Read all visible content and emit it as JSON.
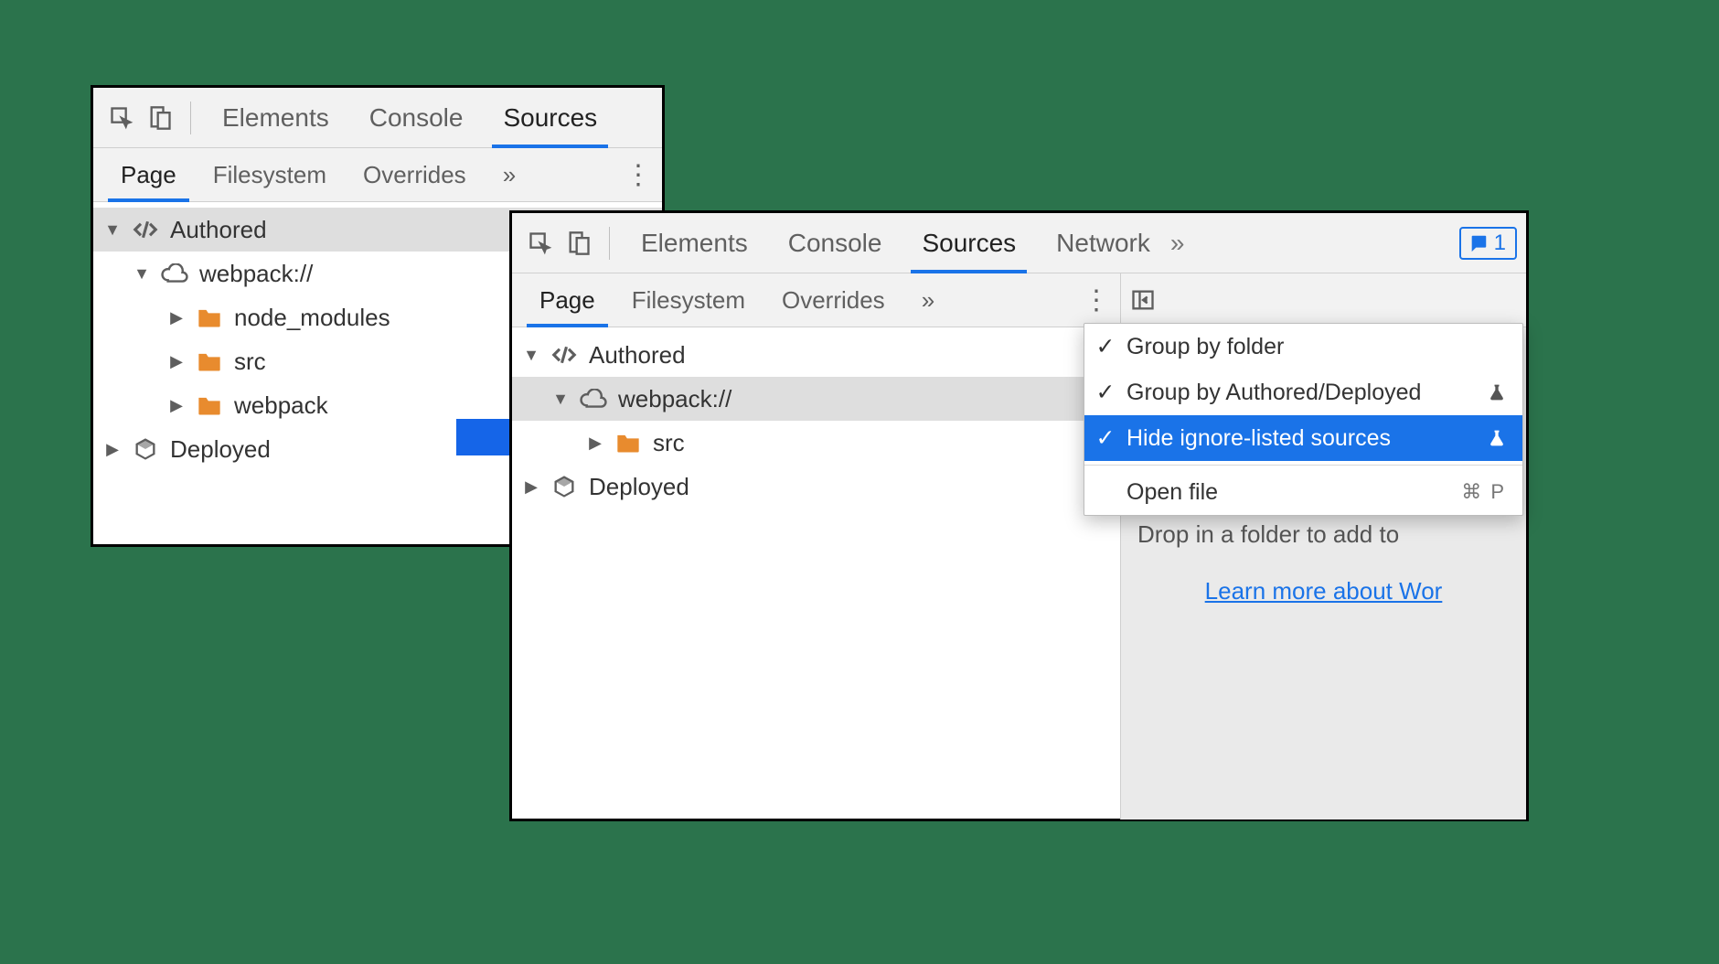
{
  "panels": {
    "left": {
      "mainTabs": [
        "Elements",
        "Console",
        "Sources"
      ],
      "activeMainTab": "Sources",
      "subTabs": [
        "Page",
        "Filesystem",
        "Overrides"
      ],
      "activeSubTab": "Page",
      "tree": {
        "authored": "Authored",
        "webpack": "webpack://",
        "node_modules": "node_modules",
        "src": "src",
        "webpack_folder": "webpack",
        "deployed": "Deployed"
      }
    },
    "right": {
      "mainTabs": [
        "Elements",
        "Console",
        "Sources",
        "Network"
      ],
      "activeMainTab": "Sources",
      "issuesBadge": "1",
      "subTabs": [
        "Page",
        "Filesystem",
        "Overrides"
      ],
      "activeSubTab": "Page",
      "tree": {
        "authored": "Authored",
        "webpack": "webpack://",
        "src": "src",
        "deployed": "Deployed"
      },
      "menu": {
        "groupByFolder": "Group by folder",
        "groupByAuthored": "Group by Authored/Deployed",
        "hideIgnore": "Hide ignore-listed sources",
        "openFile": "Open file",
        "openFileShortcut": "⌘ P"
      },
      "hint": {
        "drop": "Drop in a folder to add to",
        "learn": "Learn more about Wor"
      }
    }
  }
}
